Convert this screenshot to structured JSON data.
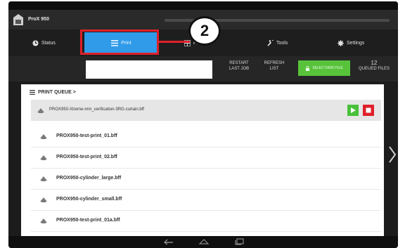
{
  "app": {
    "title": "ProX 950"
  },
  "tabs": [
    {
      "label": "Status",
      "icon": "clock-icon"
    },
    {
      "label": "Print",
      "icon": "list-icon"
    },
    {
      "label": "Printer",
      "icon": "grid-icon"
    },
    {
      "label": "Tools",
      "icon": "wrench-icon"
    },
    {
      "label": "Settings",
      "icon": "gear-icon"
    }
  ],
  "callout": {
    "number": "2"
  },
  "controls": {
    "search_placeholder": "",
    "restart_label_1": "RESTART",
    "restart_label_2": "LAST JOB",
    "refresh_label_1": "REFRESH",
    "refresh_label_2": "LIST",
    "upload_label": "SELECT/ADD FILE",
    "queued_count": "12",
    "queued_label": "QUEUED FILES"
  },
  "queue": {
    "header": "PRINT QUEUE >",
    "active_file": "PROX950-Xtreme-mm_verification-3RG-curtain.bff",
    "files": [
      "PROX950-test-print_01.bff",
      "PROX950-test-print_02.bff",
      "PROX950-cylinder_large.bff",
      "PROX950-cylinder_small.bff",
      "PROX950-test-print_01a.bff"
    ]
  },
  "colors": {
    "accent": "#2f9be9",
    "highlight": "#e0202a",
    "play": "#49c13a",
    "stop": "#e0202a"
  }
}
